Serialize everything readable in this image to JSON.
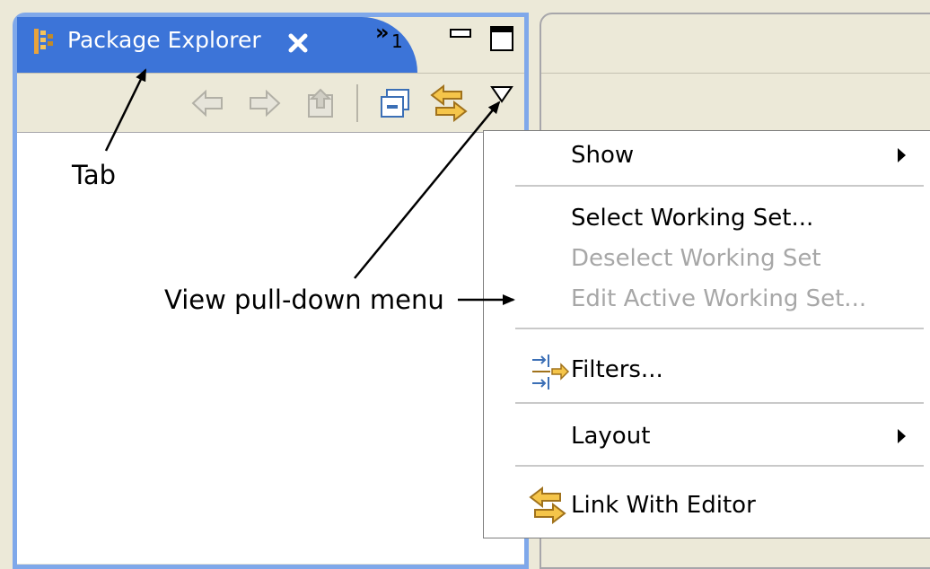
{
  "tab": {
    "title": "Package Explorer",
    "overflow_label": "»",
    "overflow_count": "1"
  },
  "menu": {
    "items": [
      {
        "label": "Show",
        "enabled": true,
        "submenu": true
      },
      {
        "label": "Select Working Set...",
        "enabled": true
      },
      {
        "label": "Deselect Working Set",
        "enabled": false
      },
      {
        "label": "Edit Active Working Set...",
        "enabled": false
      },
      {
        "label": "Filters...",
        "enabled": true,
        "icon": "filters-icon"
      },
      {
        "label": "Layout",
        "enabled": true,
        "submenu": true
      },
      {
        "label": "Link With Editor",
        "enabled": true,
        "icon": "link-with-editor-icon"
      }
    ]
  },
  "annotations": {
    "tab": "Tab",
    "view_menu": "View pull-down menu"
  },
  "colors": {
    "active_tab": "#3c74d8",
    "panel_border": "#7fa8ea",
    "background": "#ece9d8",
    "disabled_text": "#a7a7a7"
  }
}
